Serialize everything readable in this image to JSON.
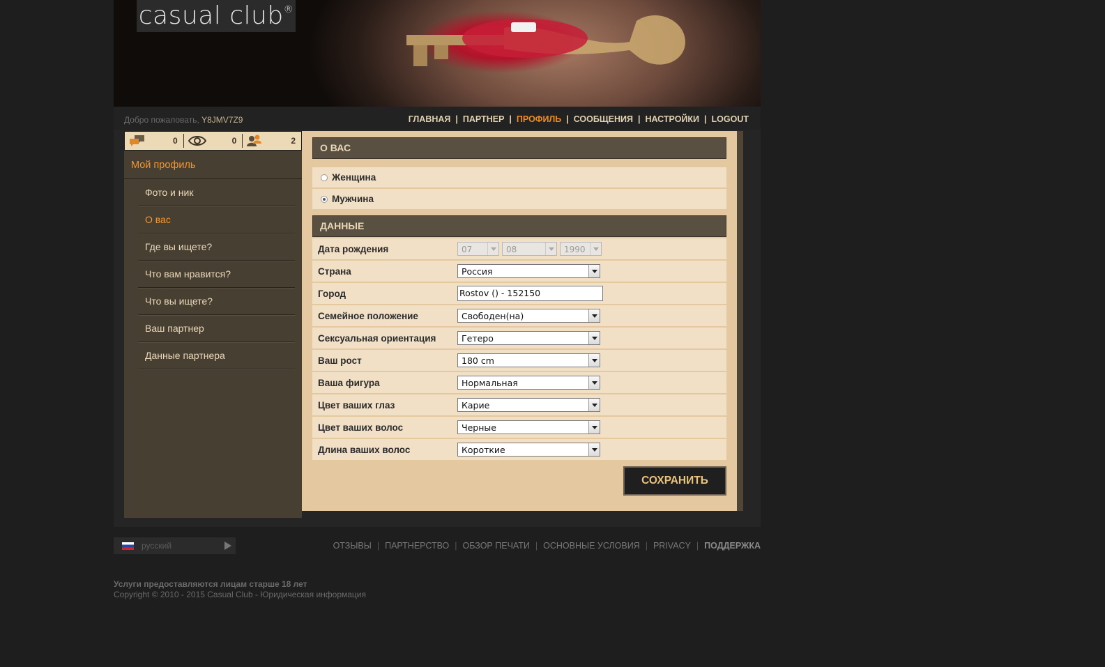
{
  "logo": {
    "text": "casual club",
    "mark": "®"
  },
  "topbar": {
    "welcome_label": "Добро пожаловать,",
    "username": "Y8JMV7Z9",
    "nav": [
      {
        "label": "ГЛАВНАЯ",
        "active": false
      },
      {
        "label": "ПАРТНЕР",
        "active": false
      },
      {
        "label": "ПРОФИЛЬ",
        "active": true
      },
      {
        "label": "СООБЩЕНИЯ",
        "active": false
      },
      {
        "label": "НАСТРОЙКИ",
        "active": false
      },
      {
        "label": "LOGOUT",
        "active": false
      }
    ]
  },
  "stats": [
    {
      "icon": "messages-icon",
      "count": "0"
    },
    {
      "icon": "eye-icon",
      "count": "0"
    },
    {
      "icon": "contacts-icon",
      "count": "2"
    }
  ],
  "sidebar": {
    "title": "Мой профиль",
    "items": [
      {
        "label": "Фото и ник",
        "active": false
      },
      {
        "label": "О вас",
        "active": true
      },
      {
        "label": "Где вы ищете?",
        "active": false
      },
      {
        "label": "Что вам нравится?",
        "active": false
      },
      {
        "label": "Что вы ищете?",
        "active": false
      },
      {
        "label": "Ваш партнер",
        "active": false
      },
      {
        "label": "Данные партнера",
        "active": false
      }
    ]
  },
  "about": {
    "header": "О ВАС",
    "gender_options": [
      {
        "label": "Женщина",
        "checked": false
      },
      {
        "label": "Мужчина",
        "checked": true
      }
    ]
  },
  "data_section": {
    "header": "ДАННЫЕ",
    "birth": {
      "label": "Дата рождения",
      "day": "07",
      "month": "08",
      "year": "1990"
    },
    "country": {
      "label": "Страна",
      "value": "Россия"
    },
    "city": {
      "label": "Город",
      "value": "Rostov () - 152150"
    },
    "marital": {
      "label": "Семейное положение",
      "value": "Свободен(на)"
    },
    "orientation": {
      "label": "Сексуальная ориентация",
      "value": "Гетеро"
    },
    "height": {
      "label": "Ваш рост",
      "value": "180 cm"
    },
    "figure": {
      "label": "Ваша фигура",
      "value": "Нормальная"
    },
    "eyes": {
      "label": "Цвет ваших глаз",
      "value": "Карие"
    },
    "hair_color": {
      "label": "Цвет ваших волос",
      "value": "Черные"
    },
    "hair_length": {
      "label": "Длина ваших волос",
      "value": "Короткие"
    }
  },
  "save_label": "СОХРАНИТЬ",
  "footer": {
    "language": "русский",
    "links": [
      "ОТЗЫВЫ",
      "ПАРТНЕРСТВО",
      "ОБЗОР ПЕЧАТИ",
      "ОСНОВНЫЕ УСЛОВИЯ",
      "PRIVACY",
      "ПОДДЕРЖКА"
    ],
    "age_notice": "Услуги предоставляются лицам старше 18 лет",
    "copyright": "Copyright © 2010 - 2015 Casual Club - Юридическая информация"
  },
  "colors": {
    "accent": "#f08c1e",
    "panel": "#e3c8a0",
    "sidebar": "#483f33"
  }
}
